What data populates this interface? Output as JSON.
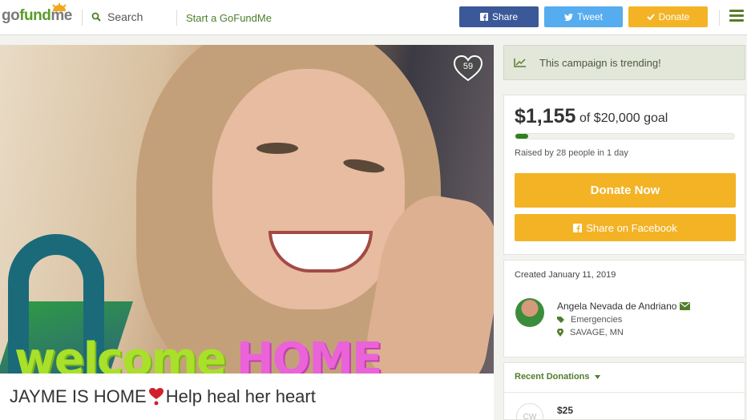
{
  "header": {
    "logo": {
      "go": "go",
      "fund": "fund",
      "me": "me"
    },
    "search_label": "Search",
    "start_label": "Start a GoFundMe",
    "share_label": "Share",
    "tweet_label": "Tweet",
    "donate_label": "Donate"
  },
  "campaign": {
    "title": "JAYME IS HOME",
    "title_suffix": " Help heal her heart",
    "hero_text_1": "welcome",
    "hero_text_2": "HOME",
    "favorites": "59"
  },
  "sidebar": {
    "trending": "This campaign is trending!",
    "raised": "$1,155",
    "goal": "of $20,000 goal",
    "progress_fraction": 0.058,
    "raised_by": "Raised by 28 people in 1 day",
    "donate_now": "Donate Now",
    "share_facebook": "Share on Facebook",
    "created": "Created January 11, 2019",
    "organizer": "Angela Nevada de Andriano",
    "category": "Emergencies",
    "location": "SAVAGE, MN",
    "recent_donations": "Recent Donations",
    "donation_avatar": "CW",
    "donation_amount": "$25"
  },
  "colors": {
    "brand_green": "#5a9c28",
    "facebook_blue": "#3b5998",
    "twitter_blue": "#55acee",
    "donate_orange": "#f3b325",
    "progress_green": "#2f7e20"
  }
}
